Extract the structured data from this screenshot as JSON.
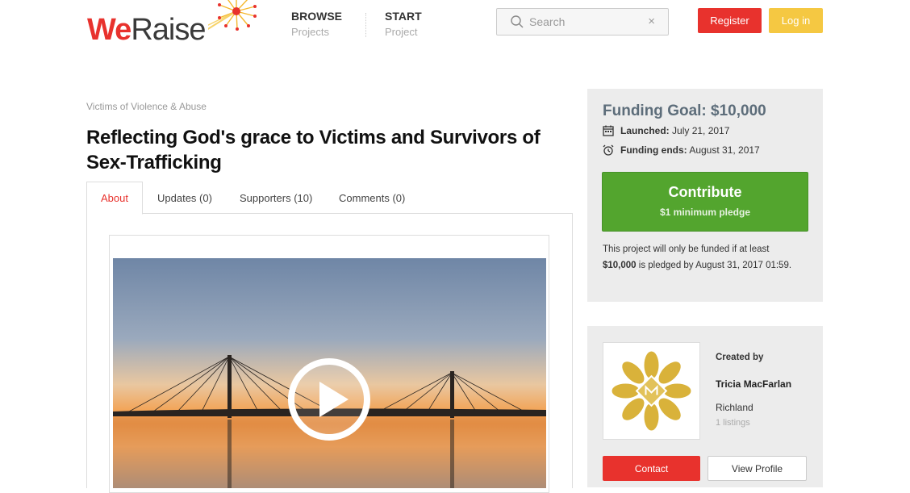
{
  "brand": {
    "we": "We",
    "raise": "Raise",
    "red": "#e8322d",
    "yellow": "#f5c842",
    "green": "#53a52e"
  },
  "nav": [
    {
      "title": "BROWSE",
      "sub": "Projects"
    },
    {
      "title": "START",
      "sub": "Project"
    }
  ],
  "search": {
    "placeholder": "Search",
    "clear": "×",
    "icon": "search-icon"
  },
  "auth": {
    "register": "Register",
    "login": "Log in"
  },
  "project": {
    "category": "Victims of Violence & Abuse",
    "title": "Reflecting God's grace to Victims and Survivors of Sex-Trafficking"
  },
  "tabs": [
    {
      "label": "About",
      "active": true
    },
    {
      "label": "Updates (0)"
    },
    {
      "label": "Supporters (10)"
    },
    {
      "label": "Comments (0)"
    }
  ],
  "funding": {
    "goal": "Funding Goal: $10,000",
    "launched_label": "Launched:",
    "launched_value": "July 21, 2017",
    "ends_label": "Funding ends:",
    "ends_value": "August 31, 2017",
    "contribute": "Contribute",
    "contribute_sub": "$1 minimum pledge",
    "note_pre": "This project will only be funded if at least",
    "note_amount": "$10,000",
    "note_post": "is pledged by August 31, 2017 01:59."
  },
  "creator": {
    "created_by": "Created by",
    "name": "Tricia MacFarlan",
    "city": "Richland",
    "listings": "1 listings",
    "contact": "Contact",
    "view_profile": "View Profile"
  }
}
